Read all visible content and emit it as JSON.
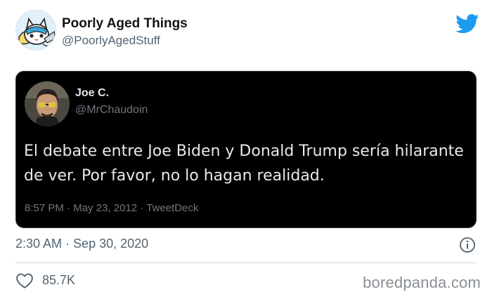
{
  "account": {
    "name": "Poorly Aged Things",
    "handle": "@PoorlyAgedStuff"
  },
  "embedded_tweet": {
    "author_name": "Joe C.",
    "author_handle": "@MrChaudoin",
    "text": "El debate entre Joe Biden y Donald Trump sería hilarante de ver. Por favor, no lo hagan realidad.",
    "time": "8:57 PM",
    "date": "May 23, 2012",
    "client": "TweetDeck"
  },
  "tweet": {
    "time": "2:30 AM",
    "date": "Sep 30, 2020",
    "likes": "85.7K"
  },
  "watermark": "boredpanda.com",
  "colors": {
    "twitter_blue": "#1d9bf0",
    "embed_bg": "#000000",
    "secondary_text": "#536471"
  },
  "icons": {
    "logo": "twitter-bird-icon",
    "info": "info-circle-icon",
    "like": "heart-outline-icon"
  }
}
